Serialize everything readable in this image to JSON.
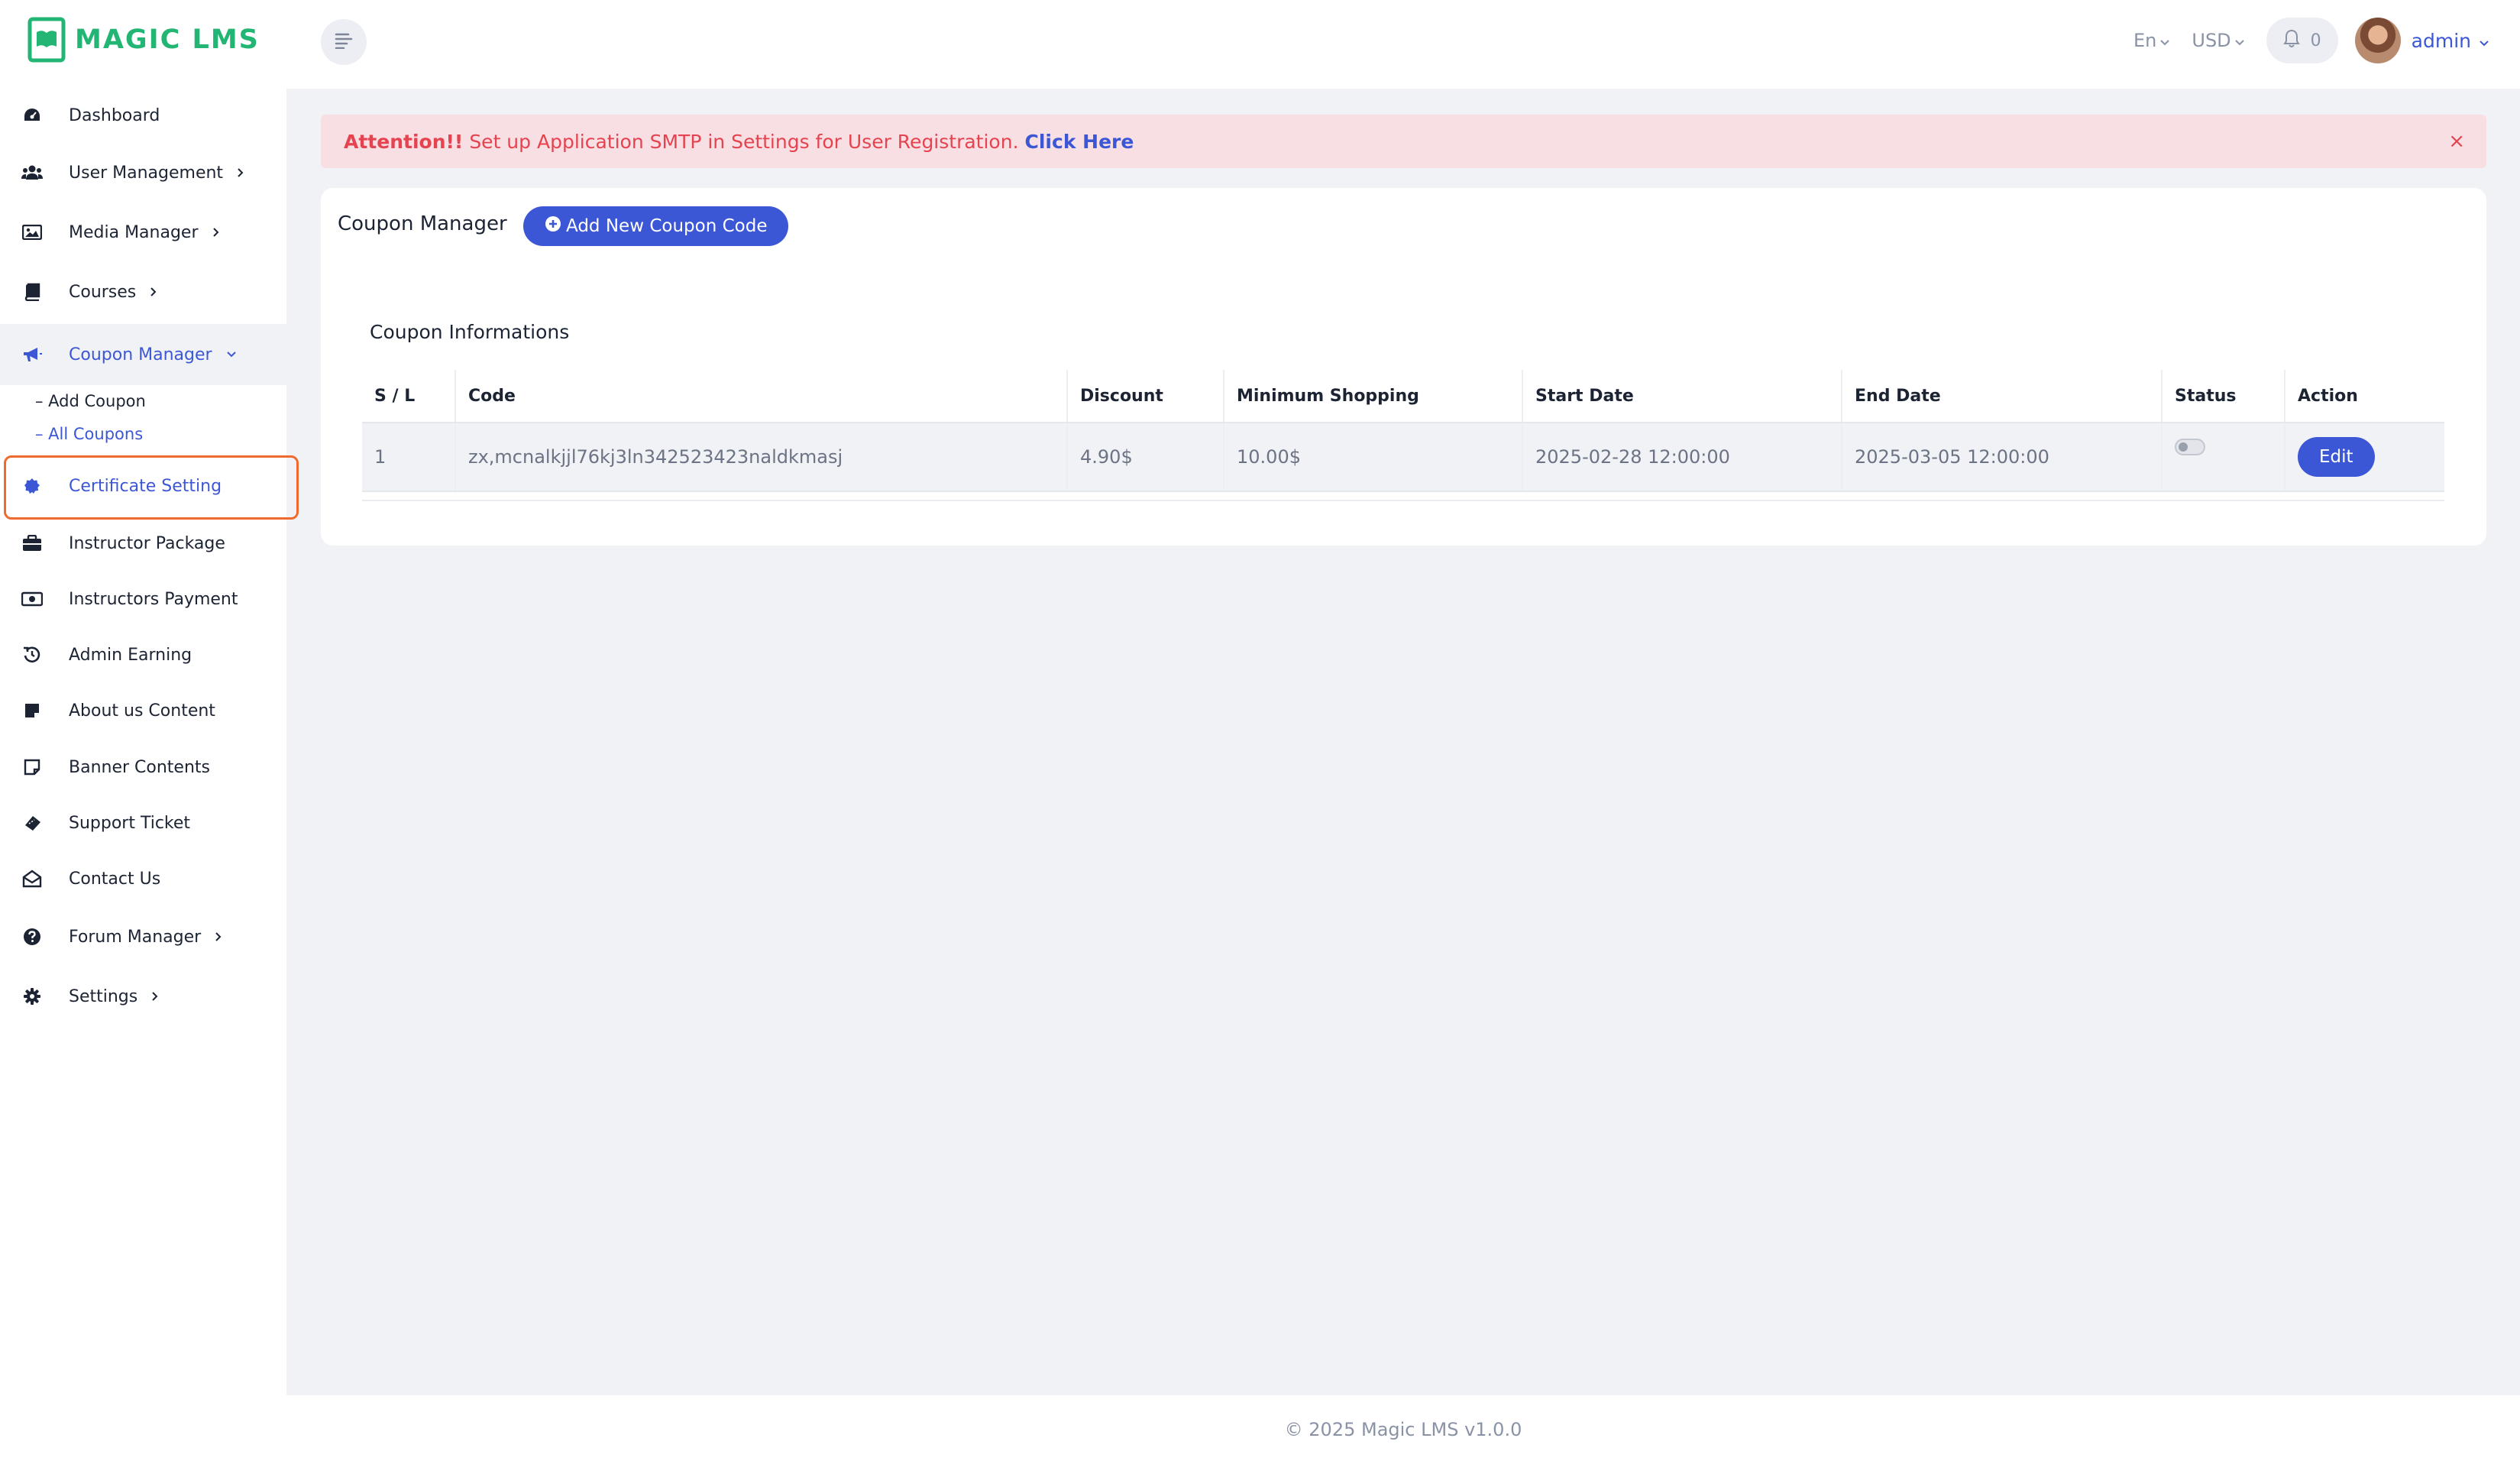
{
  "brand": {
    "name": "MAGIC LMS",
    "color": "#22b573"
  },
  "header": {
    "language": "En",
    "currency": "USD",
    "notifications_count": "0",
    "user_name": "admin"
  },
  "sidebar": {
    "items": [
      {
        "label": "Dashboard",
        "icon": "dashboard-icon"
      },
      {
        "label": "User Management",
        "icon": "users-icon"
      },
      {
        "label": "Media Manager",
        "icon": "image-icon"
      },
      {
        "label": "Courses",
        "icon": "book-icon"
      },
      {
        "label": "Coupon Manager",
        "icon": "megaphone-icon"
      },
      {
        "label": "Certificate Setting",
        "icon": "badge-icon"
      },
      {
        "label": "Instructor Package",
        "icon": "briefcase-icon"
      },
      {
        "label": "Instructors Payment",
        "icon": "money-icon"
      },
      {
        "label": "Admin Earning",
        "icon": "history-icon"
      },
      {
        "label": "About us Content",
        "icon": "note-icon"
      },
      {
        "label": "Banner Contents",
        "icon": "sticky-note-icon"
      },
      {
        "label": "Support Ticket",
        "icon": "ticket-icon"
      },
      {
        "label": "Contact Us",
        "icon": "envelope-open-icon"
      },
      {
        "label": "Forum Manager",
        "icon": "question-circle-icon"
      },
      {
        "label": "Settings",
        "icon": "gear-icon"
      }
    ],
    "coupon_sub": [
      {
        "label": "– Add Coupon"
      },
      {
        "label": "– All Coupons"
      }
    ]
  },
  "alert": {
    "strong": "Attention!!",
    "message": "Set up Application SMTP in Settings for User Registration.",
    "link": "Click Here",
    "close": "×"
  },
  "main": {
    "title": "Coupon Manager",
    "add_button": "Add New Coupon Code",
    "section_title": "Coupon Informations",
    "columns": [
      "S / L",
      "Code",
      "Discount",
      "Minimum Shopping",
      "Start Date",
      "End Date",
      "Status",
      "Action"
    ],
    "rows": [
      {
        "sl": "1",
        "code": "zx,mcnalkjjl76kj3ln342523423naldkmasj",
        "discount": "4.90$",
        "minimum": "10.00$",
        "start": "2025-02-28 12:00:00",
        "end": "2025-03-05 12:00:00",
        "status_on": false,
        "action": "Edit"
      }
    ]
  },
  "footer": {
    "text": "© 2025 Magic LMS v1.0.0"
  },
  "colors": {
    "primary": "#3c57d6",
    "alert_bg": "#f8dfe3",
    "alert_text": "#e4434f",
    "highlight": "#f06a2f"
  }
}
